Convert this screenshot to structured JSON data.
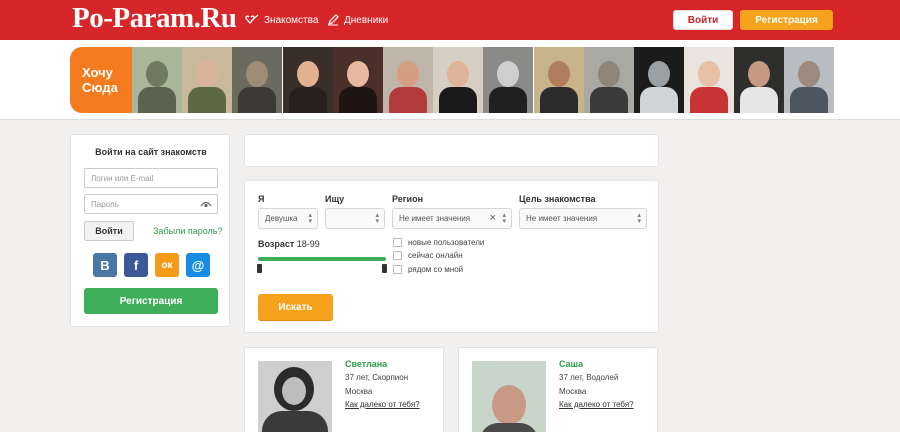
{
  "header": {
    "logo": "Po-Param.Ru",
    "nav": [
      {
        "label": "Знакомства",
        "icon": "heart-arrow-icon"
      },
      {
        "label": "Дневники",
        "icon": "pencil-icon"
      }
    ],
    "login_label": "Войти",
    "register_label": "Регистрация",
    "colors": {
      "brand": "#d7262a",
      "accent": "#f6a21c",
      "green": "#3fae5a"
    }
  },
  "promo": {
    "line1": "Хочу",
    "line2": "Сюда"
  },
  "login": {
    "title": "Войти на сайт знакомств",
    "login_placeholder": "Логин или E-mail",
    "password_placeholder": "Пароль",
    "submit_label": "Войти",
    "forgot_label": "Забыли пароль?",
    "socials": [
      {
        "label": "В",
        "icon": "vk-icon",
        "color": "#4a76a8"
      },
      {
        "label": "f",
        "icon": "facebook-icon",
        "color": "#3b5998"
      },
      {
        "label": "ок",
        "icon": "odnoklassniki-icon",
        "color": "#f39a19"
      },
      {
        "label": "@",
        "icon": "mailru-icon",
        "color": "#168de2"
      }
    ],
    "register_label": "Регистрация"
  },
  "search": {
    "i_label": "Я",
    "i_value": "Девушка",
    "seek_label": "Ищу",
    "seek_value": "",
    "region_label": "Регион",
    "region_value": "Не имеет значения",
    "goal_label": "Цель знакомства",
    "goal_value": "Не имеет значения",
    "age_label": "Возраст",
    "age_range": "18-99",
    "age_min": 18,
    "age_max": 99,
    "checks": [
      "новые пользователи",
      "сейчас онлайн",
      "рядом со мной"
    ],
    "button_label": "Искать"
  },
  "profiles": [
    {
      "name": "Светлана",
      "info1": "37 лет, Скорпион",
      "info2": "Москва",
      "link": "Как далеко от тебя?"
    },
    {
      "name": "Саша",
      "info1": "37 лет, Водолей",
      "info2": "Москва",
      "link": "Как далеко от тебя?"
    }
  ]
}
